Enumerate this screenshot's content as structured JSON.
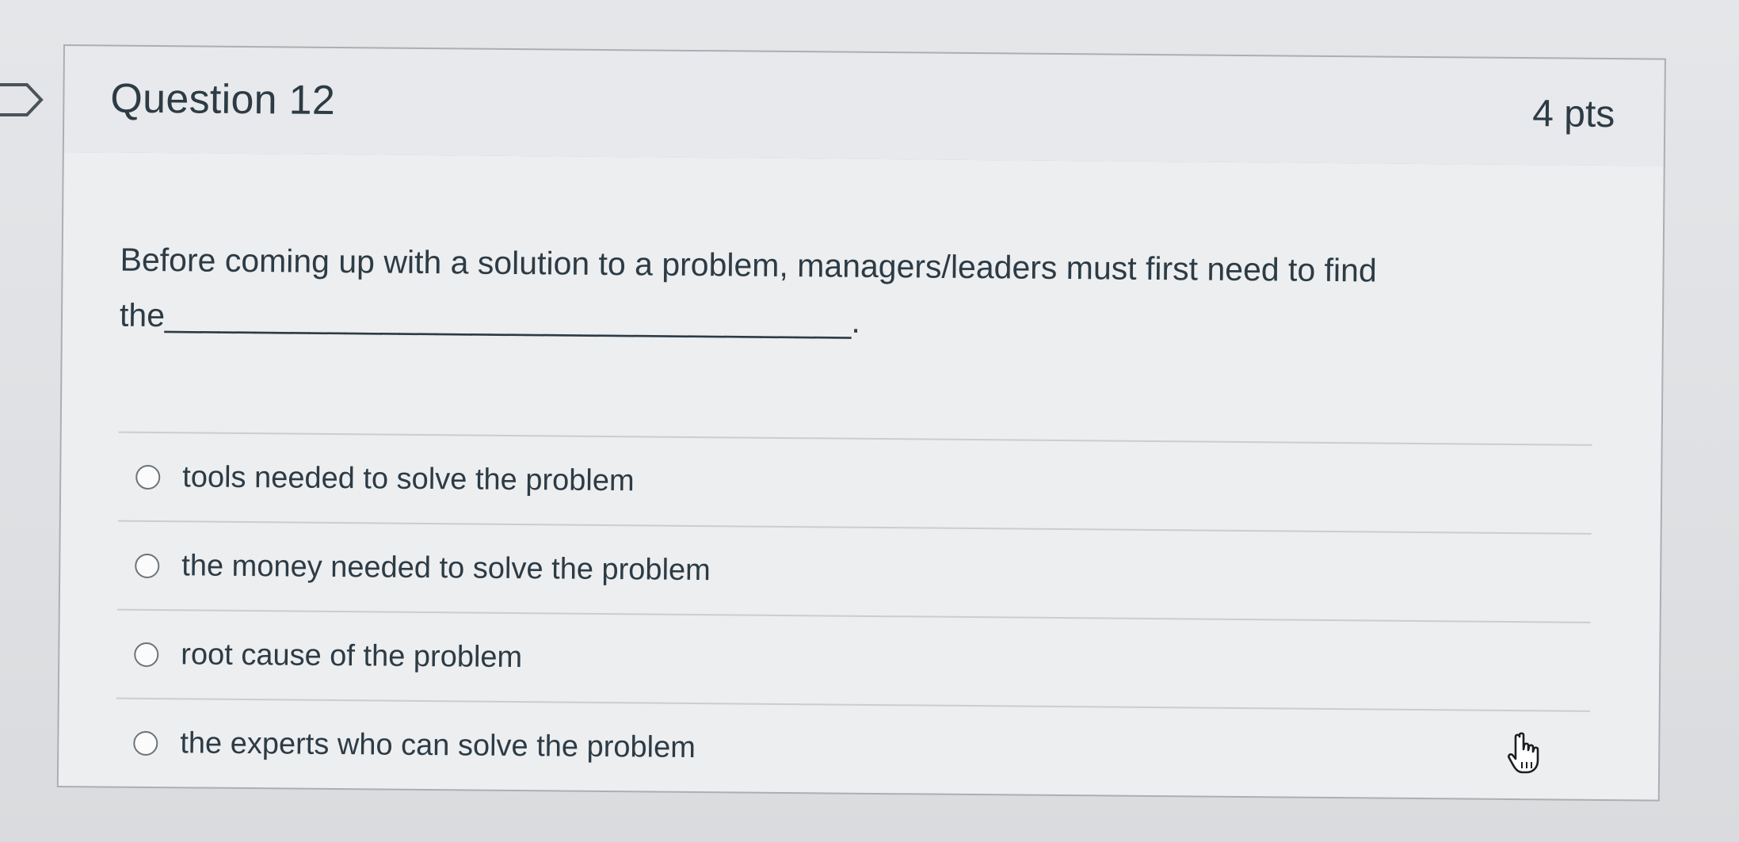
{
  "question": {
    "title": "Question 12",
    "points": "4 pts",
    "text": "Before coming up with a solution to a problem, managers/leaders must first need to find the______________________________________."
  },
  "answers": [
    {
      "label": "tools needed to solve the problem",
      "selected": false
    },
    {
      "label": "the money needed to solve the problem",
      "selected": false
    },
    {
      "label": "root cause of the problem",
      "selected": false
    },
    {
      "label": "the experts who can solve the problem",
      "selected": false
    }
  ],
  "icons": {
    "flag": "flag-icon",
    "radio": "radio-button-icon",
    "cursor": "hand-pointer-icon"
  },
  "colors": {
    "text": "#2d3b45",
    "border": "#a9afb4",
    "divider": "#c9ced2"
  }
}
